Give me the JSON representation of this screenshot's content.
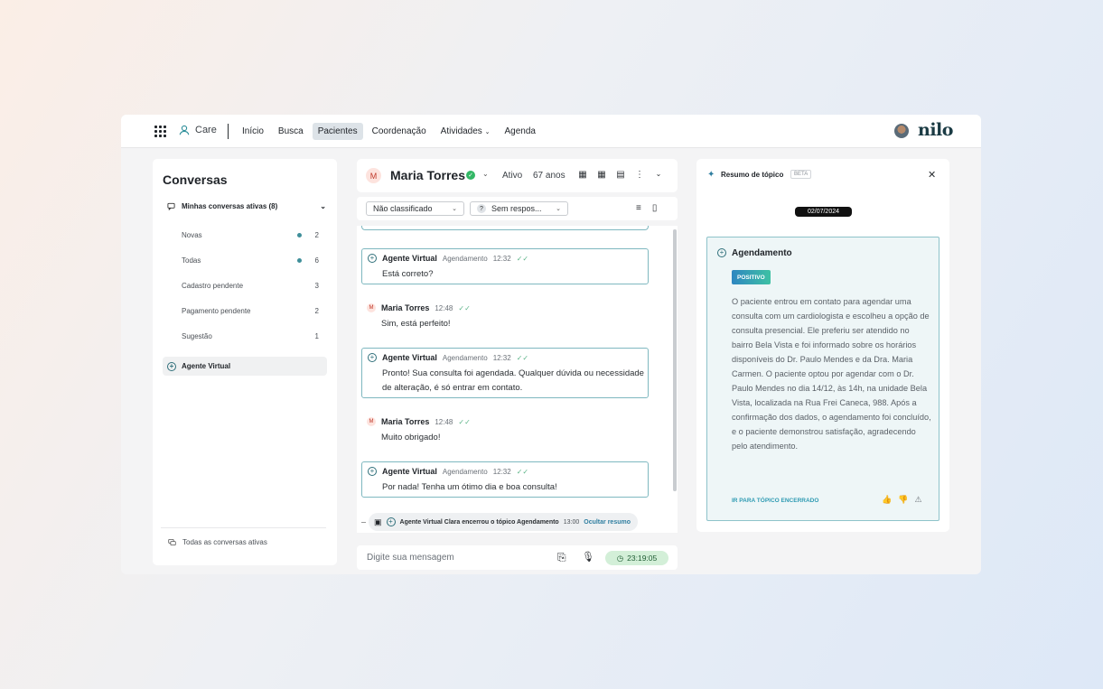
{
  "topbar": {
    "app_name": "Care",
    "nav": [
      "Início",
      "Busca",
      "Pacientes",
      "Coordenação",
      "Atividades",
      "Agenda"
    ],
    "active_nav": "Pacientes",
    "logo": "nilo"
  },
  "sidebar": {
    "title": "Conversas",
    "group_label": "Minhas conversas ativas (8)",
    "items": [
      {
        "label": "Novas",
        "count": "2",
        "dot": true
      },
      {
        "label": "Todas",
        "count": "6",
        "dot": true
      },
      {
        "label": "Cadastro pendente",
        "count": "3",
        "dot": false
      },
      {
        "label": "Pagamento pendente",
        "count": "2",
        "dot": false
      },
      {
        "label": "Sugestão",
        "count": "1",
        "dot": false
      }
    ],
    "agent_item": "Agente Virtual",
    "footer": "Todas as conversas ativas"
  },
  "patient": {
    "initial": "M",
    "name": "Maria Torres",
    "status": "Ativo",
    "age": "67 anos"
  },
  "filters": {
    "classification": "Não classificado",
    "response": "Sem respos..."
  },
  "messages": [
    {
      "type": "agent",
      "author": "Agente Virtual",
      "tag": "Agendamento",
      "time": "12:32",
      "text": "Está correto?"
    },
    {
      "type": "user",
      "author": "Maria Torres",
      "tag": "",
      "time": "12:48",
      "text": "Sim, está perfeito!"
    },
    {
      "type": "agent",
      "author": "Agente Virtual",
      "tag": "Agendamento",
      "time": "12:32",
      "text": "Pronto! Sua consulta foi agendada. Qualquer dúvida ou necessidade de alteração, é só entrar em contato."
    },
    {
      "type": "user",
      "author": "Maria Torres",
      "tag": "",
      "time": "12:48",
      "text": "Muito obrigado!"
    },
    {
      "type": "agent",
      "author": "Agente Virtual",
      "tag": "Agendamento",
      "time": "12:32",
      "text": "Por nada! Tenha um ótimo dia e boa consulta!"
    }
  ],
  "closing": {
    "text": "Agente Virtual Clara encerrou o tópico Agendamento",
    "time": "13:00",
    "hide_label": "Ocultar resumo"
  },
  "composer": {
    "placeholder": "Digite sua mensagem",
    "timer": "23:19:05"
  },
  "summary": {
    "title": "Resumo de tópico",
    "beta": "BETA",
    "date": "02/07/2024",
    "topic": "Agendamento",
    "sentiment": "POSITIVO",
    "body": "O paciente entrou em contato para agendar uma consulta com um cardiologista e escolheu a opção de consulta presencial. Ele preferiu ser atendido no bairro Bela Vista e foi informado sobre os horários disponíveis do Dr. Paulo Mendes e da Dra. Maria Carmen. O paciente optou por agendar com o Dr. Paulo Mendes no dia 14/12, às 14h, na unidade Bela Vista, localizada na Rua Frei Caneca, 988. Após a confirmação dos dados, o agendamento foi concluído, e o paciente demonstrou satisfação, agradecendo pelo atendimento.",
    "link": "IR PARA TÓPICO ENCERRADO"
  },
  "colors": {
    "accent": "#2f6f7a",
    "badge_start": "#2e86c1",
    "badge_end": "#3ec1a4",
    "timer_bg": "#d3efd8",
    "verified": "#32b765"
  }
}
